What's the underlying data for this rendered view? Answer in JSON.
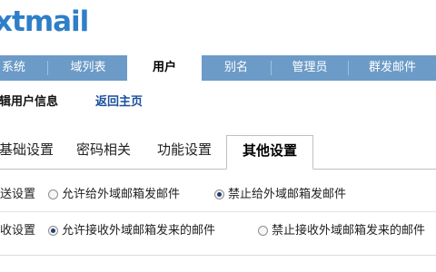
{
  "app": {
    "logo_text": "xtmail"
  },
  "nav": {
    "items": [
      {
        "label": "系统"
      },
      {
        "label": "域列表"
      },
      {
        "label": "用户"
      },
      {
        "label": "别名"
      },
      {
        "label": "管理员"
      },
      {
        "label": "群发邮件"
      }
    ],
    "active_index": 2
  },
  "subheader": {
    "title": "编辑用户信息",
    "back_link": "返回主页"
  },
  "tabs": {
    "items": [
      {
        "label": "基础设置"
      },
      {
        "label": "密码相关"
      },
      {
        "label": "功能设置"
      },
      {
        "label": "其他设置"
      }
    ],
    "active_index": 3
  },
  "settings": [
    {
      "label": "发送设置",
      "options": [
        {
          "label": "允许给外域邮箱发邮件",
          "selected": false
        },
        {
          "label": "禁止给外域邮箱发邮件",
          "selected": true
        }
      ]
    },
    {
      "label": "接收设置",
      "options": [
        {
          "label": "允许接收外域邮箱发来的邮件",
          "selected": true
        },
        {
          "label": "禁止接收外域邮箱发来的邮件",
          "selected": false
        }
      ]
    }
  ],
  "colors": {
    "nav_bg": "#6c9bc7",
    "logo": "#2e7fc7",
    "link": "#1a4f9c"
  }
}
